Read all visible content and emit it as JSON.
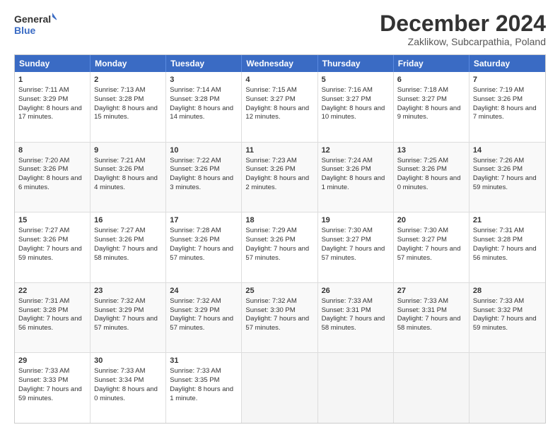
{
  "logo": {
    "line1": "General",
    "line2": "Blue"
  },
  "title": "December 2024",
  "subtitle": "Zaklikow, Subcarpathia, Poland",
  "header_days": [
    "Sunday",
    "Monday",
    "Tuesday",
    "Wednesday",
    "Thursday",
    "Friday",
    "Saturday"
  ],
  "weeks": [
    [
      {
        "day": "1",
        "rise": "Sunrise: 7:11 AM",
        "set": "Sunset: 3:29 PM",
        "light": "Daylight: 8 hours and 17 minutes."
      },
      {
        "day": "2",
        "rise": "Sunrise: 7:13 AM",
        "set": "Sunset: 3:28 PM",
        "light": "Daylight: 8 hours and 15 minutes."
      },
      {
        "day": "3",
        "rise": "Sunrise: 7:14 AM",
        "set": "Sunset: 3:28 PM",
        "light": "Daylight: 8 hours and 14 minutes."
      },
      {
        "day": "4",
        "rise": "Sunrise: 7:15 AM",
        "set": "Sunset: 3:27 PM",
        "light": "Daylight: 8 hours and 12 minutes."
      },
      {
        "day": "5",
        "rise": "Sunrise: 7:16 AM",
        "set": "Sunset: 3:27 PM",
        "light": "Daylight: 8 hours and 10 minutes."
      },
      {
        "day": "6",
        "rise": "Sunrise: 7:18 AM",
        "set": "Sunset: 3:27 PM",
        "light": "Daylight: 8 hours and 9 minutes."
      },
      {
        "day": "7",
        "rise": "Sunrise: 7:19 AM",
        "set": "Sunset: 3:26 PM",
        "light": "Daylight: 8 hours and 7 minutes."
      }
    ],
    [
      {
        "day": "8",
        "rise": "Sunrise: 7:20 AM",
        "set": "Sunset: 3:26 PM",
        "light": "Daylight: 8 hours and 6 minutes."
      },
      {
        "day": "9",
        "rise": "Sunrise: 7:21 AM",
        "set": "Sunset: 3:26 PM",
        "light": "Daylight: 8 hours and 4 minutes."
      },
      {
        "day": "10",
        "rise": "Sunrise: 7:22 AM",
        "set": "Sunset: 3:26 PM",
        "light": "Daylight: 8 hours and 3 minutes."
      },
      {
        "day": "11",
        "rise": "Sunrise: 7:23 AM",
        "set": "Sunset: 3:26 PM",
        "light": "Daylight: 8 hours and 2 minutes."
      },
      {
        "day": "12",
        "rise": "Sunrise: 7:24 AM",
        "set": "Sunset: 3:26 PM",
        "light": "Daylight: 8 hours and 1 minute."
      },
      {
        "day": "13",
        "rise": "Sunrise: 7:25 AM",
        "set": "Sunset: 3:26 PM",
        "light": "Daylight: 8 hours and 0 minutes."
      },
      {
        "day": "14",
        "rise": "Sunrise: 7:26 AM",
        "set": "Sunset: 3:26 PM",
        "light": "Daylight: 7 hours and 59 minutes."
      }
    ],
    [
      {
        "day": "15",
        "rise": "Sunrise: 7:27 AM",
        "set": "Sunset: 3:26 PM",
        "light": "Daylight: 7 hours and 59 minutes."
      },
      {
        "day": "16",
        "rise": "Sunrise: 7:27 AM",
        "set": "Sunset: 3:26 PM",
        "light": "Daylight: 7 hours and 58 minutes."
      },
      {
        "day": "17",
        "rise": "Sunrise: 7:28 AM",
        "set": "Sunset: 3:26 PM",
        "light": "Daylight: 7 hours and 57 minutes."
      },
      {
        "day": "18",
        "rise": "Sunrise: 7:29 AM",
        "set": "Sunset: 3:26 PM",
        "light": "Daylight: 7 hours and 57 minutes."
      },
      {
        "day": "19",
        "rise": "Sunrise: 7:30 AM",
        "set": "Sunset: 3:27 PM",
        "light": "Daylight: 7 hours and 57 minutes."
      },
      {
        "day": "20",
        "rise": "Sunrise: 7:30 AM",
        "set": "Sunset: 3:27 PM",
        "light": "Daylight: 7 hours and 57 minutes."
      },
      {
        "day": "21",
        "rise": "Sunrise: 7:31 AM",
        "set": "Sunset: 3:28 PM",
        "light": "Daylight: 7 hours and 56 minutes."
      }
    ],
    [
      {
        "day": "22",
        "rise": "Sunrise: 7:31 AM",
        "set": "Sunset: 3:28 PM",
        "light": "Daylight: 7 hours and 56 minutes."
      },
      {
        "day": "23",
        "rise": "Sunrise: 7:32 AM",
        "set": "Sunset: 3:29 PM",
        "light": "Daylight: 7 hours and 57 minutes."
      },
      {
        "day": "24",
        "rise": "Sunrise: 7:32 AM",
        "set": "Sunset: 3:29 PM",
        "light": "Daylight: 7 hours and 57 minutes."
      },
      {
        "day": "25",
        "rise": "Sunrise: 7:32 AM",
        "set": "Sunset: 3:30 PM",
        "light": "Daylight: 7 hours and 57 minutes."
      },
      {
        "day": "26",
        "rise": "Sunrise: 7:33 AM",
        "set": "Sunset: 3:31 PM",
        "light": "Daylight: 7 hours and 58 minutes."
      },
      {
        "day": "27",
        "rise": "Sunrise: 7:33 AM",
        "set": "Sunset: 3:31 PM",
        "light": "Daylight: 7 hours and 58 minutes."
      },
      {
        "day": "28",
        "rise": "Sunrise: 7:33 AM",
        "set": "Sunset: 3:32 PM",
        "light": "Daylight: 7 hours and 59 minutes."
      }
    ],
    [
      {
        "day": "29",
        "rise": "Sunrise: 7:33 AM",
        "set": "Sunset: 3:33 PM",
        "light": "Daylight: 7 hours and 59 minutes."
      },
      {
        "day": "30",
        "rise": "Sunrise: 7:33 AM",
        "set": "Sunset: 3:34 PM",
        "light": "Daylight: 8 hours and 0 minutes."
      },
      {
        "day": "31",
        "rise": "Sunrise: 7:33 AM",
        "set": "Sunset: 3:35 PM",
        "light": "Daylight: 8 hours and 1 minute."
      },
      {
        "day": "",
        "empty": true
      },
      {
        "day": "",
        "empty": true
      },
      {
        "day": "",
        "empty": true
      },
      {
        "day": "",
        "empty": true
      }
    ]
  ]
}
